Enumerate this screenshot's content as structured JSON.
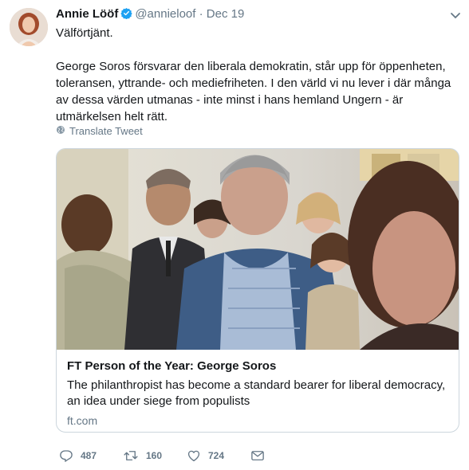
{
  "tweet": {
    "display_name": "Annie Lööf",
    "handle": "@annieloof",
    "separator": "·",
    "date": "Dec 19",
    "text_lines": [
      "Välförtjänt.",
      "George Soros försvarar den liberala demokratin, står upp för öppenheten, toleransen, yttrande- och mediefriheten. I den värld vi nu lever i där många av dessa värden utmanas - inte minst i hans hemland Ungern - är utmärkelsen helt rätt."
    ],
    "translate_label": "Translate Tweet"
  },
  "card": {
    "title": "FT Person of the Year: George Soros",
    "description": "The philanthropist has become a standard bearer for liberal democracy, an idea under siege from populists",
    "domain": "ft.com"
  },
  "actions": {
    "replies": "487",
    "retweets": "160",
    "likes": "724"
  },
  "icons": {
    "verified": "verified-badge-icon",
    "caret": "chevron-down-icon",
    "globe": "globe-icon",
    "reply": "reply-icon",
    "retweet": "retweet-icon",
    "like": "heart-icon",
    "dm": "envelope-icon"
  },
  "colors": {
    "text": "#14171a",
    "secondary": "#657786",
    "verified": "#1da1f2",
    "border": "#ccd6dd"
  }
}
